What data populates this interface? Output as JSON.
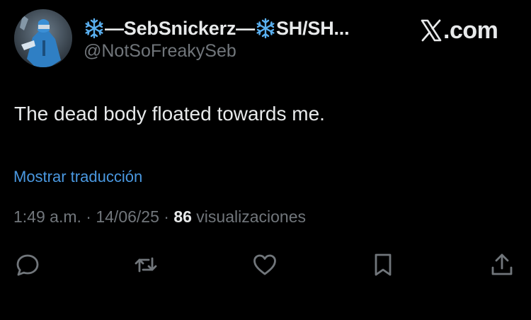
{
  "user": {
    "display_name": "—SebSnickerz— ",
    "display_name_suffix": " SH/SH...",
    "handle": "@NotSoFreakySeb",
    "name_icon": "snowflake-icon"
  },
  "brand": {
    "domain_text": ".com",
    "logo_icon": "x-logo-icon"
  },
  "tweet": {
    "text": "The dead body floated towards me.",
    "translate_link": "Mostrar traducción",
    "time": "1:49 a.m.",
    "separator1": " · ",
    "date": "14/06/25",
    "separator2": " · ",
    "views_count": "86",
    "views_label": " visualizaciones"
  },
  "actions": [
    {
      "name": "reply",
      "icon": "reply-icon"
    },
    {
      "name": "repost",
      "icon": "repost-icon"
    },
    {
      "name": "like",
      "icon": "heart-icon"
    },
    {
      "name": "bookmark",
      "icon": "bookmark-icon"
    },
    {
      "name": "share",
      "icon": "share-icon"
    }
  ],
  "colors": {
    "background": "#000000",
    "text_primary": "#e7e9ea",
    "text_secondary": "#71767b",
    "link": "#4a98e0",
    "snowflake": "#5ab0f0"
  }
}
